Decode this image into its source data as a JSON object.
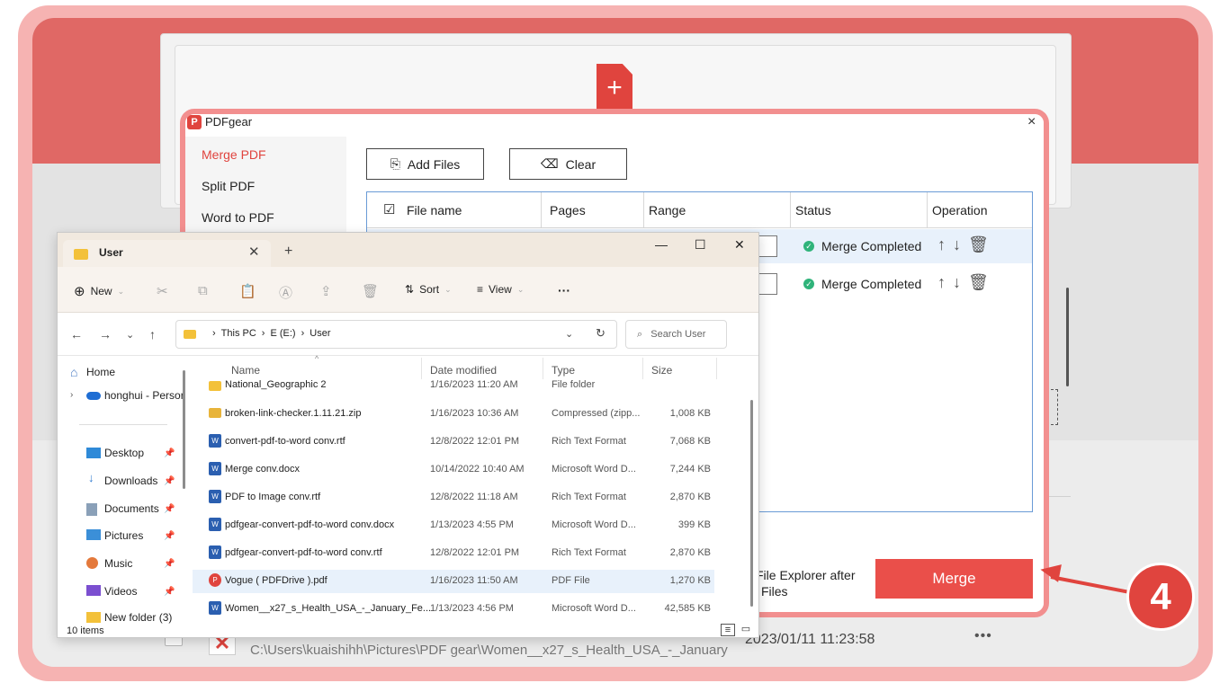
{
  "background_app": {
    "last_row_path": "C:\\Users\\kuaishihh\\Pictures\\PDF gear\\Women__x27_s_Health_USA_-_January",
    "last_row_date": "2023/01/11 11:23:58",
    "last_row_more": "•••"
  },
  "pdfgear": {
    "title": "PDFgear",
    "logo": "P",
    "close": "×",
    "sidebar": [
      "Merge PDF",
      "Split PDF",
      "Word to PDF"
    ],
    "add_files_label": "Add Files",
    "clear_label": "Clear",
    "columns": [
      "File name",
      "Pages",
      "Range",
      "Status",
      "Operation"
    ],
    "rows": [
      {
        "status": "Merge Completed",
        "ops": "↑↓🗑"
      },
      {
        "status": "Merge Completed",
        "ops": "↑↓🗑"
      }
    ],
    "open_after_label_1": "File Explorer after",
    "open_after_label_2": "Files",
    "merge_label": "Merge"
  },
  "explorer": {
    "tab_label": "User",
    "toolbar": {
      "new": "New",
      "sort": "Sort",
      "view": "View",
      "more": "···"
    },
    "breadcrumbs": [
      "This PC",
      "E (E:)",
      "User"
    ],
    "search_placeholder": "Search User",
    "nav": {
      "home": "Home",
      "onedrive": "honghui - Persor",
      "desktop": "Desktop",
      "downloads": "Downloads",
      "documents": "Documents",
      "pictures": "Pictures",
      "music": "Music",
      "videos": "Videos",
      "newfolder": "New folder (3)"
    },
    "columns": {
      "name": "Name",
      "date": "Date modified",
      "type": "Type",
      "size": "Size"
    },
    "files": [
      {
        "name": "National_Geographic 2",
        "date": "1/16/2023 11:20 AM",
        "type": "File folder",
        "size": "",
        "kind": "folder"
      },
      {
        "name": "broken-link-checker.1.11.21.zip",
        "date": "1/16/2023 10:36 AM",
        "type": "Compressed (zipp...",
        "size": "1,008 KB",
        "kind": "zip"
      },
      {
        "name": "convert-pdf-to-word conv.rtf",
        "date": "12/8/2022 12:01 PM",
        "type": "Rich Text Format",
        "size": "7,068 KB",
        "kind": "word"
      },
      {
        "name": "Merge conv.docx",
        "date": "10/14/2022 10:40 AM",
        "type": "Microsoft Word D...",
        "size": "7,244 KB",
        "kind": "word"
      },
      {
        "name": "PDF to Image conv.rtf",
        "date": "12/8/2022 11:18 AM",
        "type": "Rich Text Format",
        "size": "2,870 KB",
        "kind": "word"
      },
      {
        "name": "pdfgear-convert-pdf-to-word conv.docx",
        "date": "1/13/2023 4:55 PM",
        "type": "Microsoft Word D...",
        "size": "399 KB",
        "kind": "word"
      },
      {
        "name": "pdfgear-convert-pdf-to-word conv.rtf",
        "date": "12/8/2022 12:01 PM",
        "type": "Rich Text Format",
        "size": "2,870 KB",
        "kind": "word"
      },
      {
        "name": "Vogue ( PDFDrive ).pdf",
        "date": "1/16/2023 11:50 AM",
        "type": "PDF File",
        "size": "1,270 KB",
        "kind": "pdf"
      },
      {
        "name": "Women__x27_s_Health_USA_-_January_Fe...",
        "date": "1/13/2023 4:56 PM",
        "type": "Microsoft Word D...",
        "size": "42,585 KB",
        "kind": "word"
      }
    ],
    "status": "10 items"
  },
  "step_number": "4",
  "colors": {
    "accent": "#e0443e",
    "merge_button": "#ea4f4a",
    "frame": "#f6b3b2"
  }
}
